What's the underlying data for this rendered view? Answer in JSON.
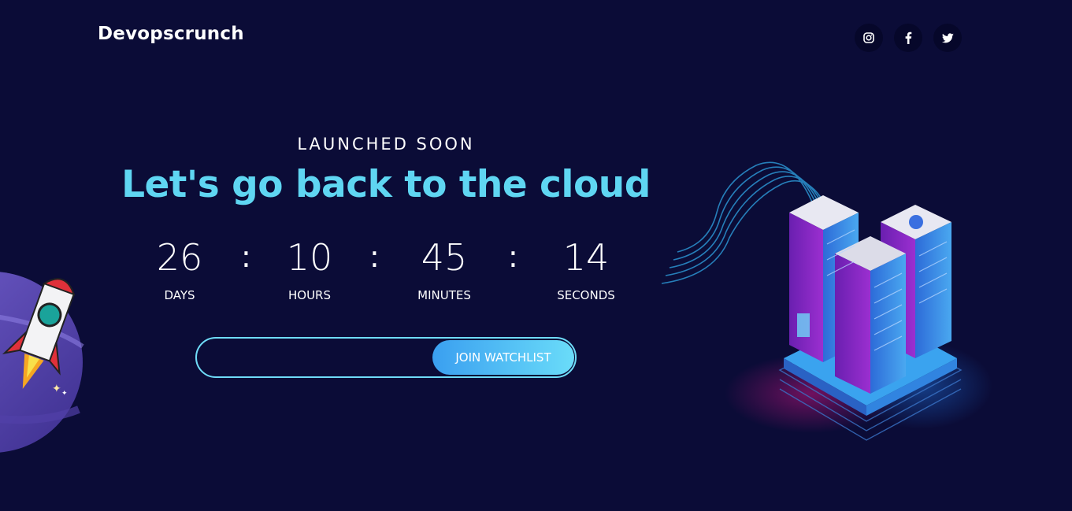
{
  "header": {
    "brand": "Devopscrunch",
    "socials": [
      {
        "name": "instagram",
        "icon": "instagram-icon"
      },
      {
        "name": "facebook",
        "icon": "facebook-icon"
      },
      {
        "name": "twitter",
        "icon": "twitter-icon"
      }
    ]
  },
  "hero": {
    "eyebrow": "LAUNCHED SOON",
    "headline": "Let's go back to the cloud"
  },
  "countdown": {
    "days": {
      "value": "26",
      "label": "DAYS"
    },
    "hours": {
      "value": "10",
      "label": "HOURS"
    },
    "minutes": {
      "value": "45",
      "label": "MINUTES"
    },
    "seconds": {
      "value": "14",
      "label": "SECONDS"
    },
    "separator": ":"
  },
  "watchlist": {
    "email_placeholder": "",
    "button_label": "JOIN WATCHLIST"
  },
  "colors": {
    "background": "#0b0c37",
    "accent": "#5fd6f2",
    "button_gradient_start": "#3a9ff0",
    "button_gradient_end": "#6adcf9"
  },
  "illustrations": {
    "left": "rocket-planet-illustration",
    "right": "isometric-server-cluster-illustration"
  }
}
